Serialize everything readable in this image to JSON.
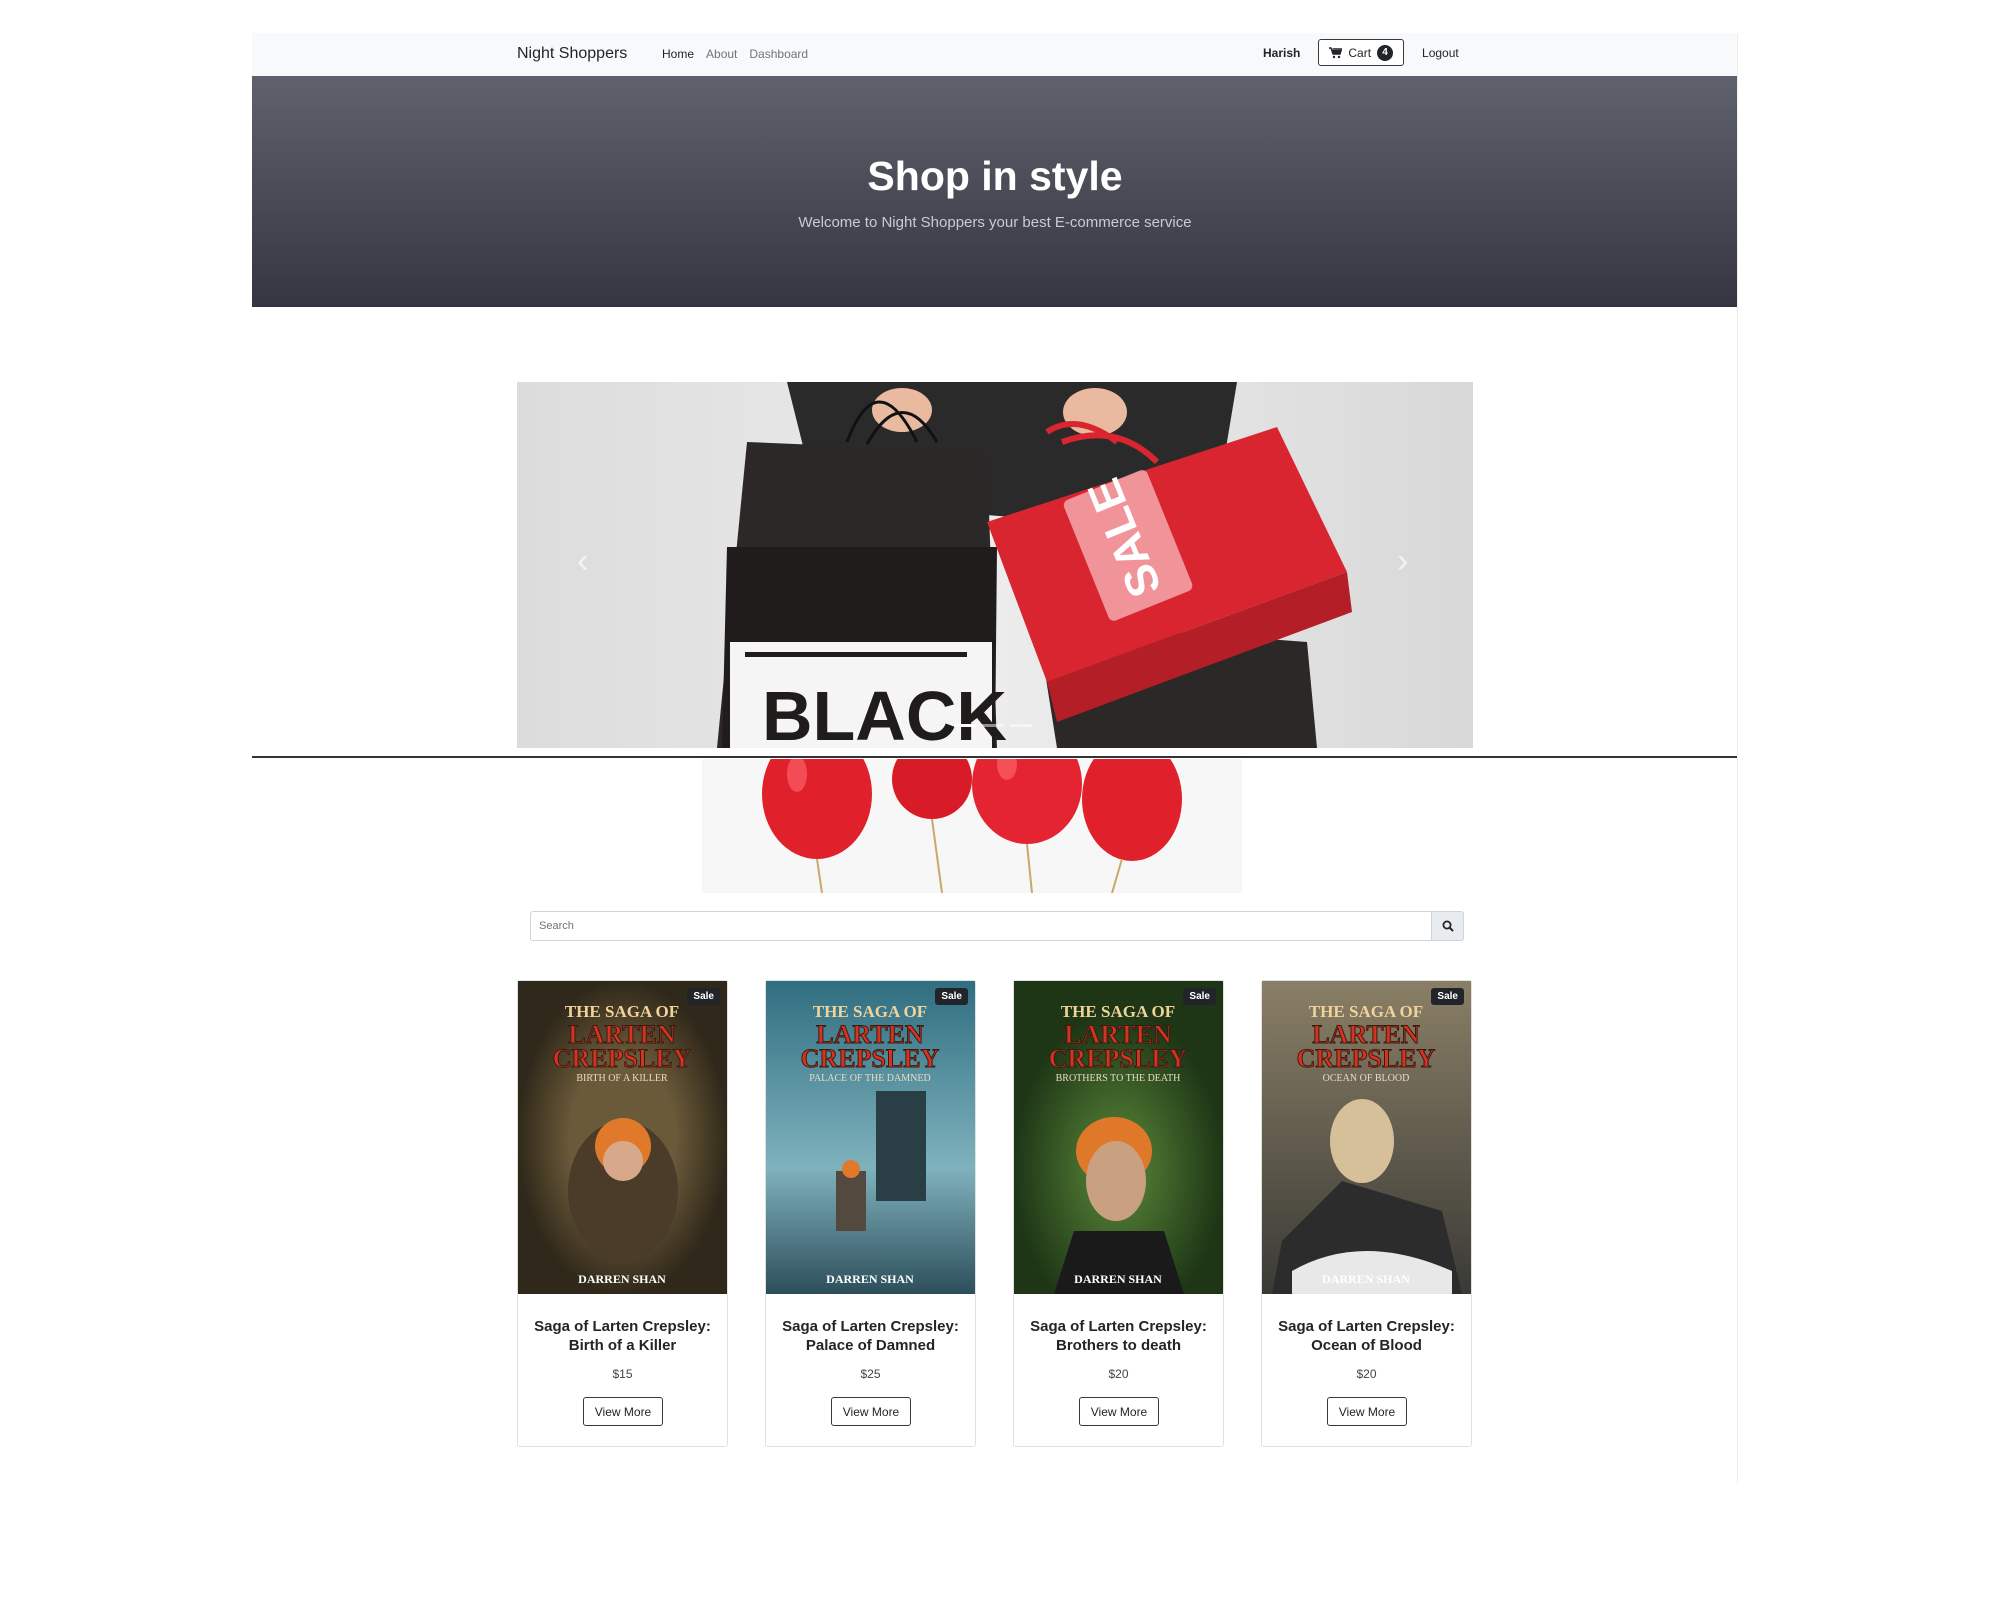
{
  "navbar": {
    "brand": "Night Shoppers",
    "links": [
      "Home",
      "About",
      "Dashboard"
    ],
    "user": "Harish",
    "cart_label": "Cart",
    "cart_count": "4",
    "logout": "Logout"
  },
  "hero": {
    "title": "Shop in style",
    "subtitle": "Welcome to Night Shoppers your best E-commerce service"
  },
  "carousel": {
    "slide_count": 3,
    "active_index": 0,
    "bag_text_1": "BLACK",
    "bag_text_2": "SALE"
  },
  "search": {
    "placeholder": "Search"
  },
  "products": [
    {
      "badge": "Sale",
      "title": "Saga of Larten Crepsley: Birth of a Killer",
      "price": "$15",
      "button": "View More",
      "cover": {
        "line1": "THE SAGA OF",
        "line2": "LARTEN",
        "line3": "CREPSLEY",
        "subtitle": "BIRTH OF A KILLER",
        "author": "DARREN SHAN",
        "color": "#6b5a3a"
      }
    },
    {
      "badge": "Sale",
      "title": "Saga of Larten Crepsley: Palace of Damned",
      "price": "$25",
      "button": "View More",
      "cover": {
        "line1": "THE SAGA OF",
        "line2": "LARTEN",
        "line3": "CREPSLEY",
        "subtitle": "PALACE OF THE DAMNED",
        "author": "DARREN SHAN",
        "color": "#3f7e8f"
      }
    },
    {
      "badge": "Sale",
      "title": "Saga of Larten Crepsley: Brothers to death",
      "price": "$20",
      "button": "View More",
      "cover": {
        "line1": "THE SAGA OF",
        "line2": "LARTEN",
        "line3": "CREPSLEY",
        "subtitle": "BROTHERS TO THE DEATH",
        "author": "DARREN SHAN",
        "color": "#3a5e2c"
      }
    },
    {
      "badge": "Sale",
      "title": "Saga of Larten Crepsley: Ocean of Blood",
      "price": "$20",
      "button": "View More",
      "cover": {
        "line1": "THE SAGA OF",
        "line2": "LARTEN",
        "line3": "CREPSLEY",
        "subtitle": "OCEAN OF BLOOD",
        "author": "DARREN SHAN",
        "color": "#6a6456"
      }
    }
  ],
  "colors": {
    "hero_top": "#5f616c",
    "hero_bottom": "#343540",
    "accent_red": "#e8333c",
    "dark": "#212529"
  }
}
